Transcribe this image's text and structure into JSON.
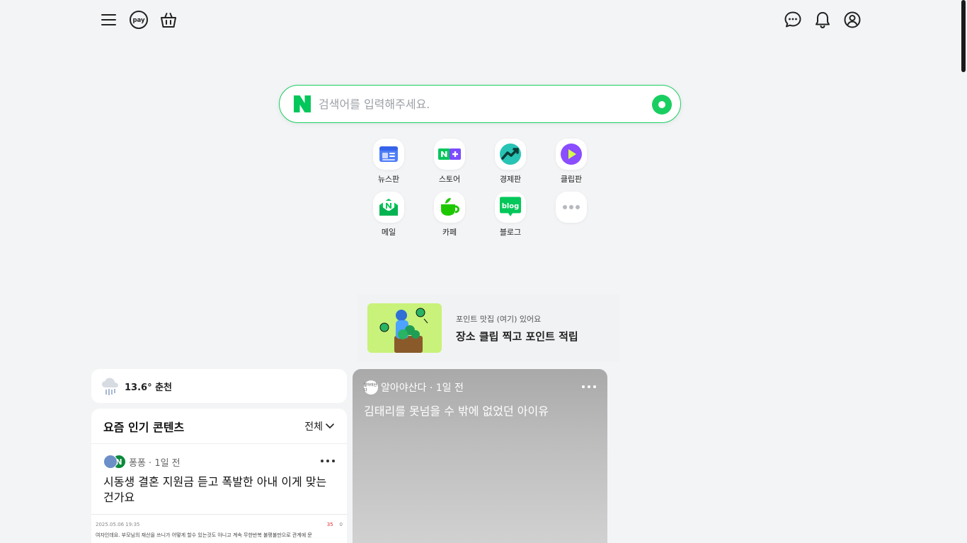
{
  "toolbar": {
    "menu_icon": "hamburger-menu-icon",
    "pay_label": "pay",
    "cart_icon": "shopping-bag-icon",
    "chat_icon": "chat-icon",
    "notification_icon": "bell-icon",
    "profile_icon": "user-icon"
  },
  "search": {
    "placeholder": "검색어를 입력해주세요.",
    "value": "",
    "accent": "#19ce60"
  },
  "shortcuts": [
    {
      "label": "뉴스판",
      "icon": "news-icon"
    },
    {
      "label": "스토어",
      "icon": "store-icon"
    },
    {
      "label": "경제판",
      "icon": "economy-icon"
    },
    {
      "label": "클립판",
      "icon": "clip-play-icon"
    },
    {
      "label": "메일",
      "icon": "mail-icon"
    },
    {
      "label": "카페",
      "icon": "cafe-cup-icon"
    },
    {
      "label": "블로그",
      "icon": "blog-icon"
    },
    {
      "label": "",
      "icon": "more-dots-icon"
    }
  ],
  "promo": {
    "subtitle": "포인트 맛집 (여기) 있어요",
    "title": "장소 클립 찍고 포인트 적립"
  },
  "weather": {
    "text": "13.6° 춘천",
    "icon": "rain-cloud-icon"
  },
  "popular": {
    "title": "요즘 인기 콘텐츠",
    "filter": "전체",
    "items": [
      {
        "author": "퐁퐁 · 1일 전",
        "badge": "N",
        "title": "시동생 결혼 지원금 듣고 폭발한 아내 이게 맞는건가요",
        "thumb_date": "2025.05.06 19:35",
        "thumb_likes": "35",
        "thumb_comments": "0",
        "thumb_text": "여자인데요. 부모님의 재산을 쓰니가 어떻게 할수 있는것도 아니고 계속 무한반복 불평불만으로 관계에 문"
      }
    ]
  },
  "card": {
    "channel_logo": "알아야산다",
    "meta": "알아야산다 · 1일 전",
    "title": "김태리를 못넘을 수 밖에 없었던 아이유"
  }
}
